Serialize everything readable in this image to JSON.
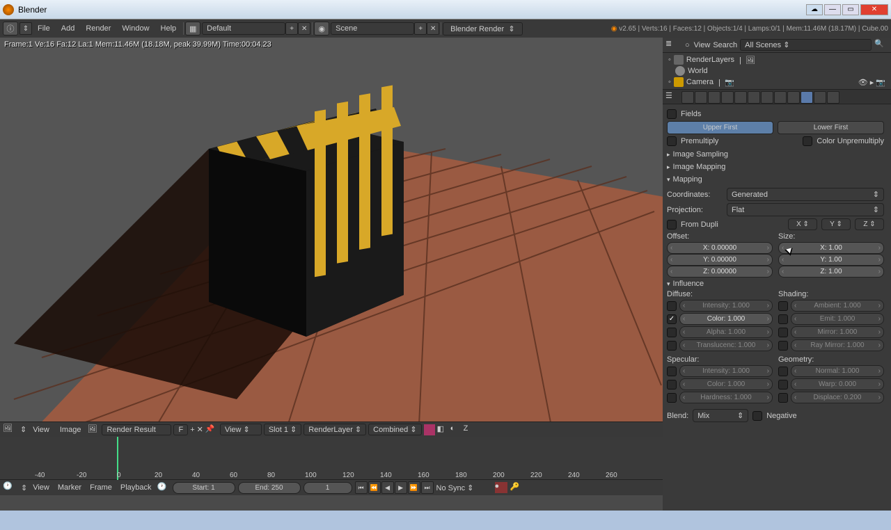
{
  "window": {
    "title": "Blender"
  },
  "menubar": {
    "items": [
      "File",
      "Add",
      "Render",
      "Window",
      "Help"
    ],
    "layout": "Default",
    "scene": "Scene",
    "renderer": "Blender Render",
    "status": "v2.65 | Verts:16 | Faces:12 | Objects:1/4 | Lamps:0/1 | Mem:11.46M (18.17M) | Cube.00"
  },
  "viewport": {
    "info": "Frame:1 Ve:16 Fa:12 La:1 Mem:11.46M (18.18M, peak 39.99M) Time:00:04.23"
  },
  "imagebar": {
    "view": "View",
    "image": "Image",
    "result": "Render Result",
    "f": "F",
    "viewmode": "View",
    "slot": "Slot 1",
    "layer": "RenderLayer",
    "pass": "Combined"
  },
  "timeline": {
    "ticks": [
      "-40",
      "-20",
      "0",
      "20",
      "40",
      "60",
      "80",
      "100",
      "120",
      "140",
      "160",
      "180",
      "200",
      "220",
      "240",
      "260"
    ],
    "menus": [
      "View",
      "Marker",
      "Frame",
      "Playback"
    ],
    "start": "Start: 1",
    "end": "End: 250",
    "current": "1",
    "sync": "No Sync"
  },
  "outliner": {
    "view": "View",
    "search": "Search",
    "filter": "All Scenes",
    "items": [
      "RenderLayers",
      "World",
      "Camera"
    ]
  },
  "props": {
    "fields": "Fields",
    "upper": "Upper First",
    "lower": "Lower First",
    "premul": "Premultiply",
    "unpremul": "Color Unpremultiply",
    "p1": "Image Sampling",
    "p2": "Image Mapping",
    "p3": "Mapping",
    "coords_lbl": "Coordinates:",
    "coords_val": "Generated",
    "proj_lbl": "Projection:",
    "proj_val": "Flat",
    "dupli": "From Dupli",
    "offset": "Offset:",
    "size": "Size:",
    "ox": "X: 0.00000",
    "oy": "Y: 0.00000",
    "oz": "Z: 0.00000",
    "sx": "X: 1.00",
    "sy": "Y: 1.00",
    "sz": "Z: 1.00",
    "p4": "Influence",
    "diffuse": "Diffuse:",
    "shading": "Shading:",
    "d_int": "Intensity: 1.000",
    "s_amb": "Ambient: 1.000",
    "d_col": "Color: 1.000",
    "s_emit": "Emit: 1.000",
    "d_alp": "Alpha: 1.000",
    "s_mir": "Mirror: 1.000",
    "d_tra": "Translucenc: 1.000",
    "s_ray": "Ray Mirror: 1.000",
    "specular": "Specular:",
    "geometry": "Geometry:",
    "sp_int": "Intensity: 1.000",
    "g_nor": "Normal: 1.000",
    "sp_col": "Color: 1.000",
    "g_war": "Warp: 0.000",
    "sp_har": "Hardness: 1.000",
    "g_dis": "Displace: 0.200",
    "blend_lbl": "Blend:",
    "blend_val": "Mix",
    "neg": "Negative"
  }
}
